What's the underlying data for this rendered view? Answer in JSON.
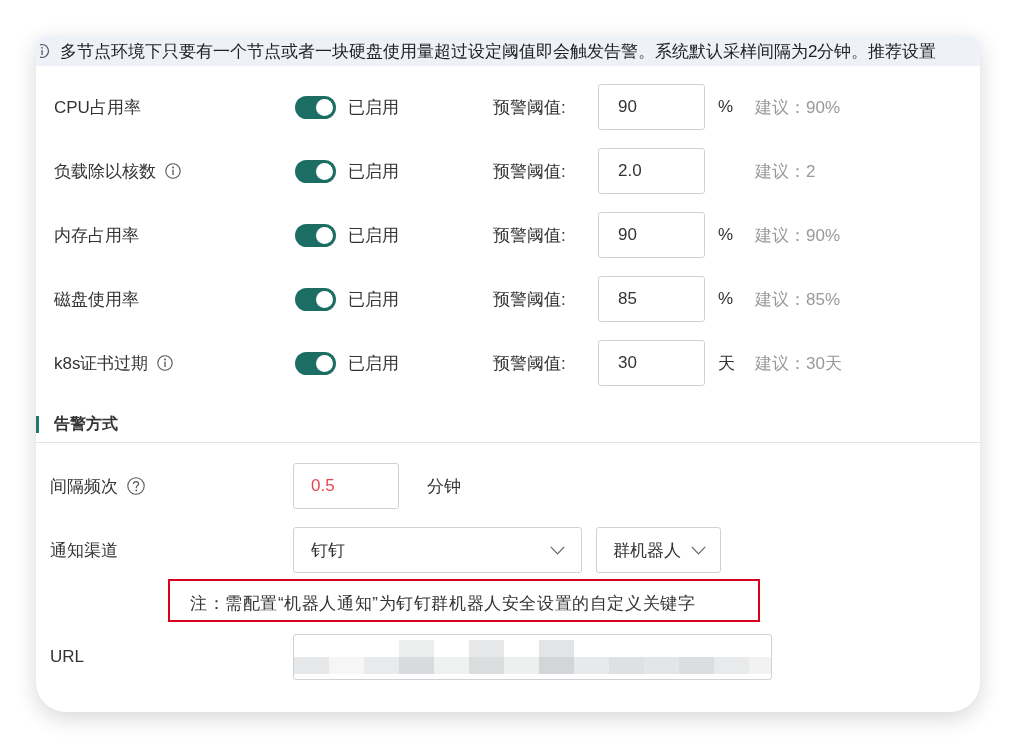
{
  "notice": {
    "text": "多节点环境下只要有一个节点或者一块硬盘使用量超过设定阈值即会触发告警。系统默认采样间隔为2分钟。推荐设置"
  },
  "metrics": [
    {
      "label": "CPU占用率",
      "info_icon": false,
      "enabled": true,
      "status": "已启用",
      "threshold_label": "预警阈值:",
      "value": "90",
      "unit": "%",
      "suggestion": "建议：90%"
    },
    {
      "label": "负载除以核数",
      "info_icon": true,
      "enabled": true,
      "status": "已启用",
      "threshold_label": "预警阈值:",
      "value": "2.0",
      "suggestion": "建议：2"
    },
    {
      "label": "内存占用率",
      "info_icon": false,
      "enabled": true,
      "status": "已启用",
      "threshold_label": "预警阈值:",
      "value": "90",
      "unit": "%",
      "suggestion": "建议：90%"
    },
    {
      "label": "磁盘使用率",
      "info_icon": false,
      "enabled": true,
      "status": "已启用",
      "threshold_label": "预警阈值:",
      "value": "85",
      "unit": "%",
      "suggestion": "建议：85%"
    },
    {
      "label": "k8s证书过期",
      "info_icon": true,
      "enabled": true,
      "status": "已启用",
      "threshold_label": "预警阈值:",
      "value": "30",
      "unit": "天",
      "suggestion": "建议：30天"
    }
  ],
  "alert_method": {
    "title": "告警方式",
    "interval": {
      "label": "间隔频次",
      "value": "0.5",
      "invalid": true,
      "unit": "分钟"
    },
    "channel": {
      "label": "通知渠道",
      "provider": "钉钉",
      "type": "群机器人"
    },
    "note": "注：需配置“机器人通知”为钉钉群机器人安全设置的自定义关键字",
    "url": {
      "label": "URL"
    }
  }
}
